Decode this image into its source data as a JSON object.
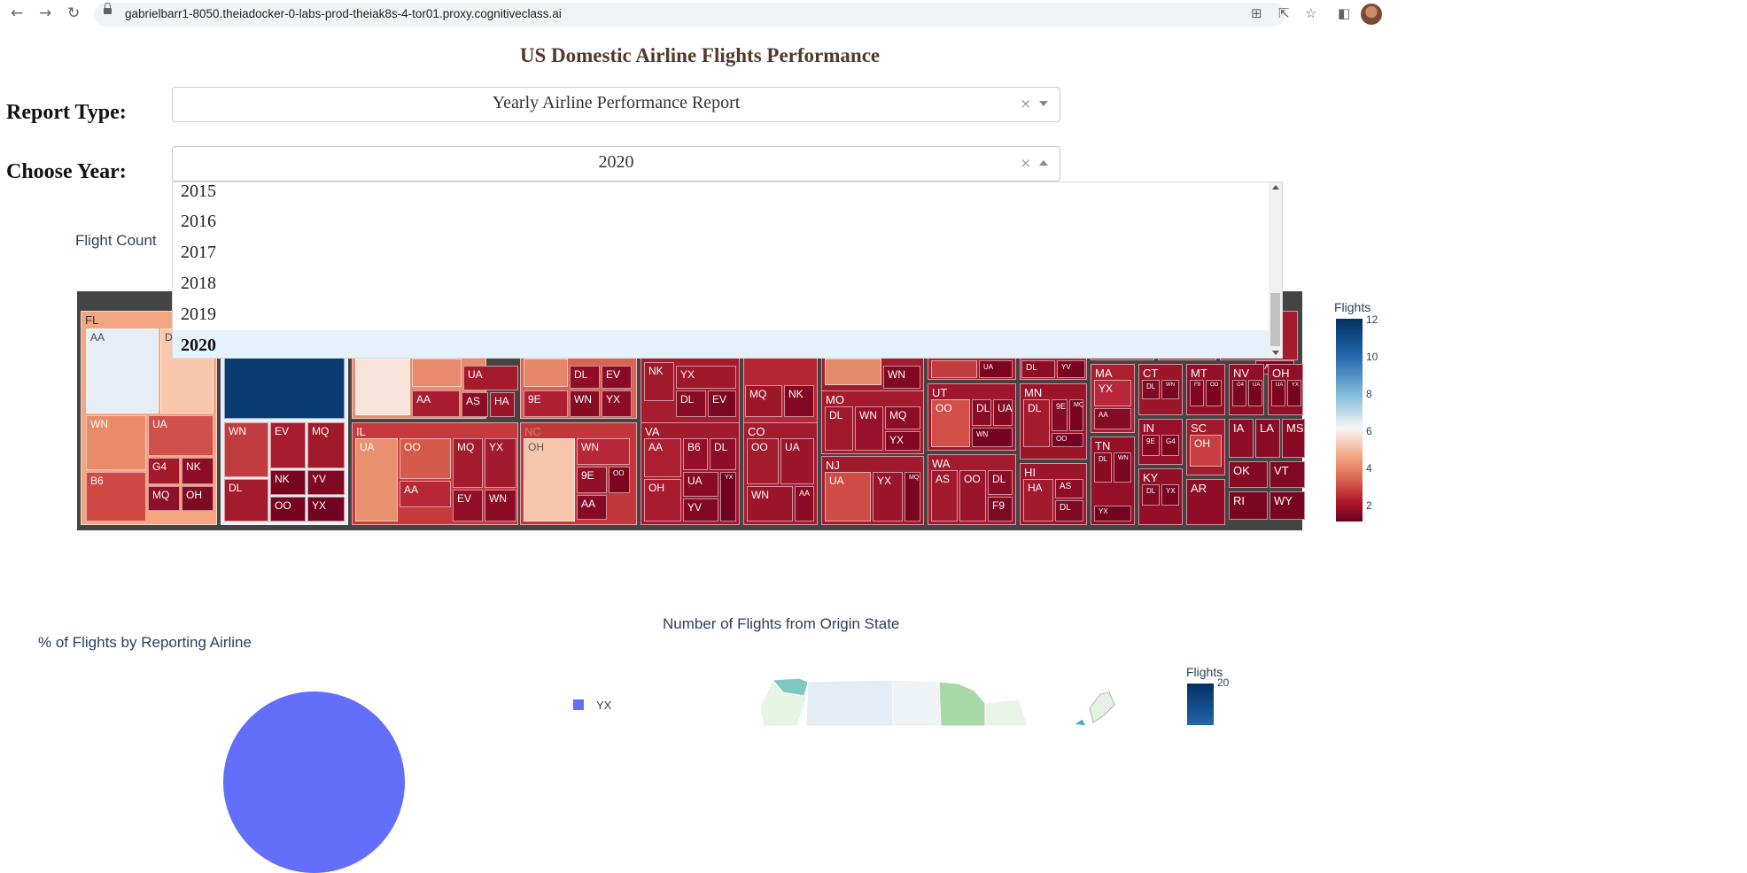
{
  "browser": {
    "url": "gabrielbarr1-8050.theiadocker-0-labs-prod-theiak8s-4-tor01.proxy.cognitiveclass.ai"
  },
  "page": {
    "title": "US Domestic Airline Flights Performance",
    "report_type_label": "Report Type:",
    "report_type_value": "Yearly Airline Performance Report",
    "year_label": "Choose Year:",
    "year_value": "2020",
    "clear_glyph": "×",
    "year_options": [
      "2015",
      "2016",
      "2017",
      "2018",
      "2019",
      "2020"
    ],
    "selected_year": "2020"
  },
  "charts": {
    "treemap_title": "Flight Count",
    "treemap_colorbar_title": "Flights",
    "treemap_colorbar_ticks": [
      "12",
      "10",
      "8",
      "6",
      "4",
      "2"
    ],
    "pie_title": "% of Flights by Reporting Airline",
    "pie_legend_first": "YX",
    "map_title": "Number of Flights from Origin State",
    "map_colorbar_title": "Flights",
    "map_colorbar_top_tick": "20"
  },
  "colors": {
    "accent_title": "#503a2e",
    "plot_text": "#2a3f5f",
    "selected_option_bg": "#e6f2fb",
    "pie_color": "#636efa"
  },
  "chart_data": [
    {
      "type": "treemap",
      "title": "Flight Count",
      "colorbar": {
        "title": "Flights",
        "range": [
          1,
          12
        ],
        "ticks": [
          2,
          4,
          6,
          8,
          10,
          12
        ]
      },
      "visible_labels": [
        "FL",
        "AA",
        "D",
        "WN",
        "UA",
        "B6",
        "G4",
        "NK",
        "MQ",
        "OH",
        "EV",
        "DL",
        "YV",
        "OO",
        "YX",
        "IL",
        "AS",
        "HA",
        "9E",
        "NC",
        "VA",
        "CO",
        "NJ",
        "MO",
        "UT",
        "WA",
        "HI",
        "MN",
        "TN",
        "MA",
        "CT",
        "MT",
        "NV",
        "IN",
        "KY",
        "SC",
        "IA",
        "LA",
        "MS",
        "OK",
        "VT",
        "RI",
        "WY",
        "AR",
        "F9"
      ]
    }
  ]
}
